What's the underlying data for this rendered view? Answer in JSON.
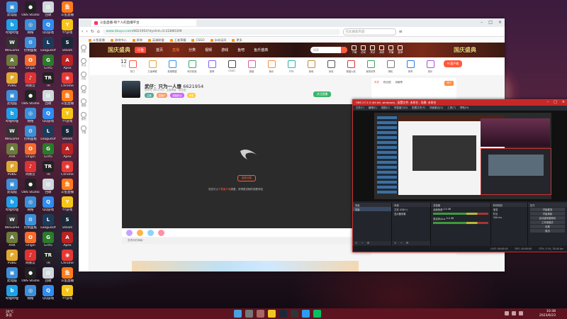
{
  "desktop": {
    "icons": [
      {
        "label": "此电脑",
        "color": "#3b8fd8",
        "glyph": "▣"
      },
      {
        "label": "OBS Studio",
        "color": "#222",
        "glyph": "●"
      },
      {
        "label": "回收",
        "color": "#cfd8dc",
        "glyph": "▤"
      },
      {
        "label": "斗鱼直播",
        "color": "#ff7b1a",
        "glyph": "鱼"
      },
      {
        "label": "哔哩哔哩",
        "color": "#1fa0e6",
        "glyph": "b"
      },
      {
        "label": "网络",
        "color": "#3b8fd8",
        "glyph": "◎"
      },
      {
        "label": "QQ游戏",
        "color": "#2f8cf0",
        "glyph": "Q"
      },
      {
        "label": "YY游戏",
        "color": "#f5c518",
        "glyph": "Y"
      },
      {
        "label": "WeGame",
        "color": "#333",
        "glyph": "W"
      },
      {
        "label": "控制面板",
        "color": "#3b8fd8",
        "glyph": "⚙"
      },
      {
        "label": "LeagueOf",
        "color": "#1c3b5a",
        "glyph": "L"
      },
      {
        "label": "Steam",
        "color": "#1b2838",
        "glyph": "S"
      },
      {
        "label": "ARK",
        "color": "#6c7a3b",
        "glyph": "A"
      },
      {
        "label": "Origin",
        "color": "#f56c2d",
        "glyph": "O"
      },
      {
        "label": "GTA5",
        "color": "#2a7b2a",
        "glyph": "G"
      },
      {
        "label": "Apex",
        "color": "#b22",
        "glyph": "A"
      },
      {
        "label": "PUBG",
        "color": "#e0a82e",
        "glyph": "P"
      },
      {
        "label": "网易云",
        "color": "#d33",
        "glyph": "♪"
      },
      {
        "label": "TR",
        "color": "#222",
        "glyph": "TR"
      },
      {
        "label": "Chrome",
        "color": "#e53935",
        "glyph": "◉"
      }
    ]
  },
  "taskbar": {
    "weather": "26°C\n多云",
    "time": "10:38",
    "date": "2023/6/23"
  },
  "browser": {
    "tab_title": "斗鱼直播-每个人的直播平台",
    "url_host": "www.douyu.com",
    "url_path": "/6621954?dyshid=0-22880309",
    "search_placeholder": "在此搜索内容",
    "bookmarks": [
      "斗鱼直播",
      "游戏中心",
      "原神",
      "英雄联盟",
      "王者荣耀",
      "CSGO",
      "永劫无间",
      "更多"
    ],
    "left_rail": [
      "历史",
      "关注",
      "分区",
      "消息",
      "视频",
      "鱼吧",
      "下载"
    ]
  },
  "douyu": {
    "banner_left": "国庆盛典",
    "banner_right": "国庆盛典",
    "logo": "斗鱼",
    "nav": [
      {
        "label": "首页",
        "active": false
      },
      {
        "label": "直播",
        "active": true
      },
      {
        "label": "分类",
        "active": false
      },
      {
        "label": "视频",
        "active": false
      },
      {
        "label": "游戏",
        "active": false
      },
      {
        "label": "鱼吧",
        "active": false
      },
      {
        "label": "鱼乐盛典",
        "active": false
      }
    ],
    "search_placeholder": "搜索",
    "header_icons": [
      "下载",
      "历史",
      "关注",
      "消息",
      "开播",
      "登录"
    ],
    "count_value": "12",
    "count_label": "关注",
    "categories": [
      "热门",
      "王者荣耀",
      "英雄联盟",
      "和平精英",
      "原神",
      "CSGO",
      "颜值",
      "鱼乐",
      "户外",
      "绝地",
      "永劫",
      "穿越火线",
      "我的世界",
      "单机",
      "体育",
      "音乐"
    ],
    "pc_button": "PC客户端",
    "room": {
      "title_prefix": "武仔：只为一人堕",
      "room_id": "6621954",
      "meta": "房间号 6621954 · 主播等级 · 粉丝团",
      "tags": [
        {
          "label": "主播",
          "color": "#5a9"
        },
        {
          "label": "直播中",
          "color": "#f96"
        },
        {
          "label": "超级粉丝",
          "color": "#c6f"
        },
        {
          "label": "荣耀",
          "color": "#fc3"
        }
      ],
      "follow_label": "关注直播"
    },
    "video": {
      "button_label": "重新加载",
      "notice_prefix": "您还可以",
      "notice_highlight": "下载客户端",
      "notice_suffix": "观看，获得更流畅的观看体验"
    },
    "chat_placeholder": "发表你的弹幕~",
    "side_tabs": [
      "贵宾",
      "粉丝团",
      "贡献榜"
    ],
    "rank_pill": "排行"
  },
  "obs": {
    "title": "OBS 27.2.3 (64 bit, windows) - 配置文件: 未命名 - 场景: 未命名",
    "menu": [
      "文件(F)",
      "编辑(E)",
      "视图(V)",
      "停靠窗口(D)",
      "配置文件(P)",
      "场景集合(S)",
      "工具(T)",
      "帮助(H)"
    ],
    "docks": {
      "scenes": {
        "header": "场景",
        "items": [
          "场景"
        ]
      },
      "sources": {
        "header": "来源",
        "items": [
          "文本 (GDI+)",
          "显示器采集"
        ]
      },
      "mixer": {
        "header": "混音器",
        "channels": [
          "桌面音频",
          "麦克风/Aux"
        ],
        "levels": [
          "0.0 dB",
          "0.0 dB"
        ]
      },
      "transitions": {
        "header": "转场特效",
        "items": [
          "渐变",
          "时长",
          "300 ms"
        ]
      },
      "controls": {
        "header": "控件",
        "buttons": [
          "开始推流",
          "开始录制",
          "启动虚拟摄像机",
          "工作室模式",
          "设置",
          "退出"
        ]
      }
    },
    "status": [
      "LIVE: 00:00:00",
      "REC: 00:00:00",
      "CPU: 3.1%, 30.00 fps"
    ]
  }
}
